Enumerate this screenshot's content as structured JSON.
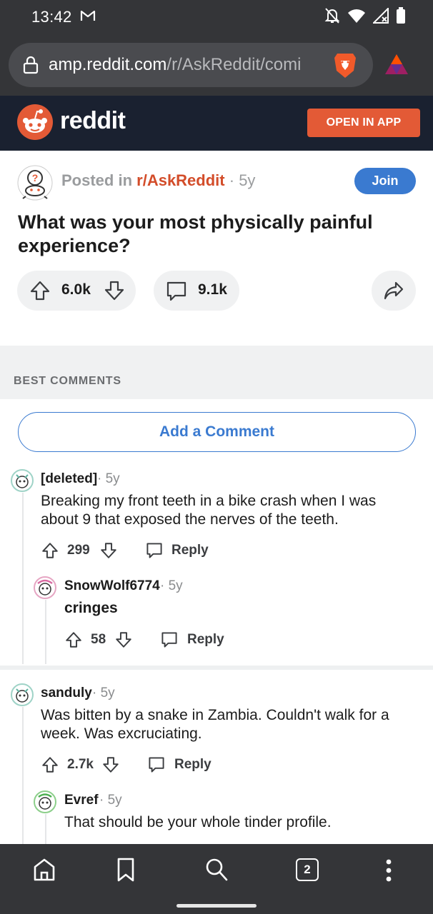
{
  "status_bar": {
    "time": "13:42",
    "icons": [
      "gmail-icon",
      "bell-off-icon",
      "wifi-icon",
      "signal-icon",
      "battery-icon"
    ]
  },
  "browser": {
    "url_host": "amp.reddit.com",
    "url_path": "/r/AskReddit/comi",
    "icons": [
      "lock-icon",
      "brave-shield-icon",
      "bat-rewards-icon"
    ]
  },
  "reddit_header": {
    "wordmark": "reddit",
    "open_in_app": "OPEN IN APP"
  },
  "post": {
    "posted_in_label": "Posted in",
    "subreddit": "r/AskReddit",
    "age": "· 5y",
    "join_label": "Join",
    "title": "What was your most physically painful experience?",
    "score": "6.0k",
    "comment_count": "9.1k"
  },
  "section_label": "BEST COMMENTS",
  "add_comment_label": "Add a Comment",
  "comments": [
    {
      "author": "[deleted]",
      "age": "· 5y",
      "body": "Breaking my front teeth in a bike crash when I was about 9 that exposed the nerves of the teeth.",
      "score": "299",
      "reply_label": "Reply",
      "replies": [
        {
          "author": "SnowWolf6774",
          "age": "· 5y",
          "body": "cringes",
          "score": "58",
          "reply_label": "Reply"
        }
      ]
    },
    {
      "author": "sanduly",
      "age": "· 5y",
      "body": "Was bitten by a snake in Zambia. Couldn't walk for a week. Was excruciating.",
      "score": "2.7k",
      "reply_label": "Reply",
      "replies": [
        {
          "author": "Evref",
          "age": "· 5y",
          "body": "That should be your whole tinder profile."
        }
      ]
    }
  ],
  "bottom_nav": {
    "tab_count": "2",
    "icons": [
      "home-icon",
      "bookmark-icon",
      "search-icon",
      "tabs-icon",
      "more-icon"
    ]
  },
  "colors": {
    "system_bar": "#343538",
    "reddit_header": "#1a2130",
    "orangered": "#e35a36",
    "blue": "#3a7ad0"
  }
}
